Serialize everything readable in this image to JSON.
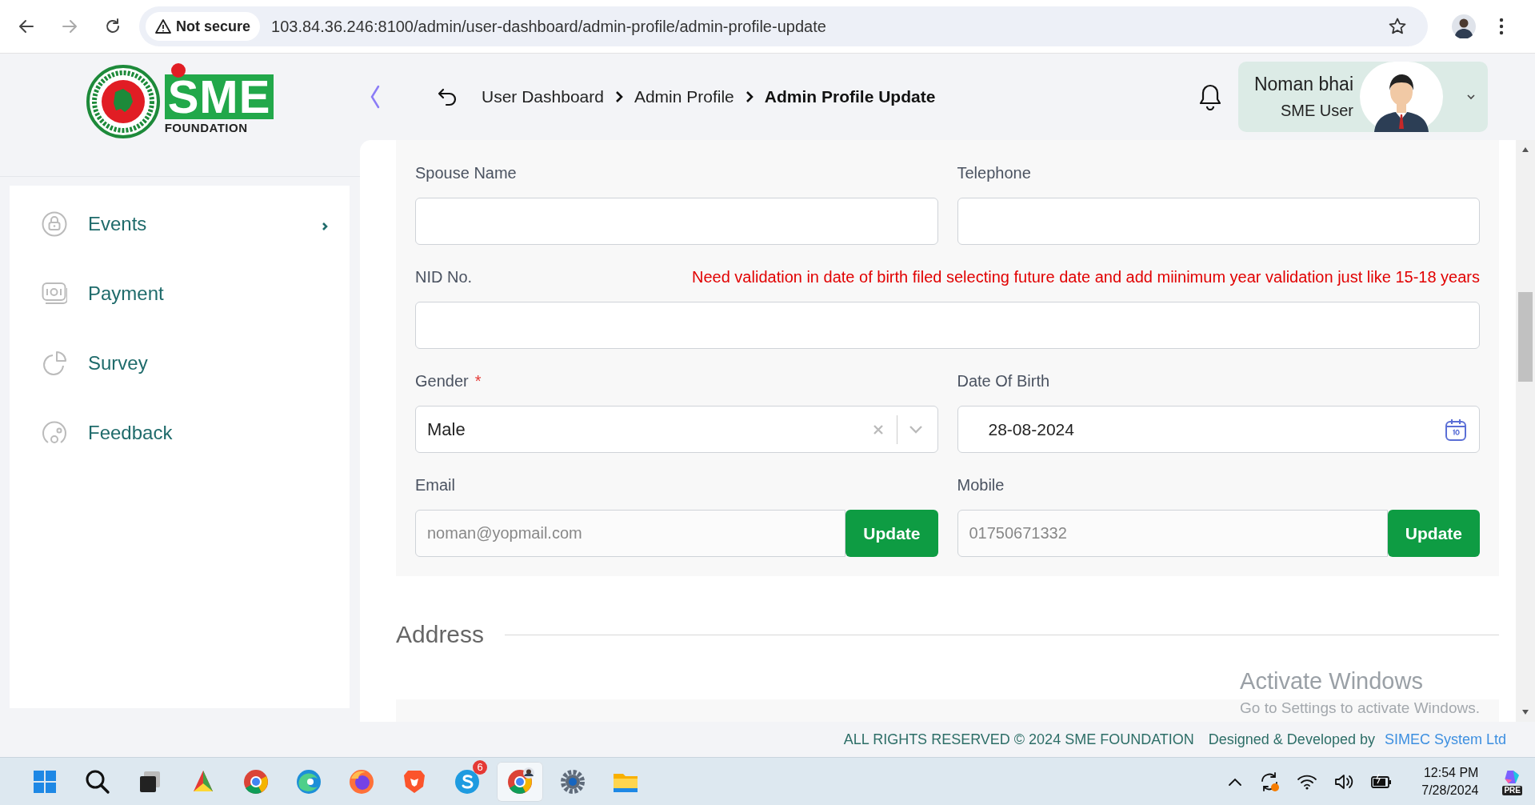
{
  "browser": {
    "security": "Not secure",
    "url": "103.84.36.246:8100/admin/user-dashboard/admin-profile/admin-profile-update"
  },
  "logo": {
    "letters": "SME",
    "subtitle": "FOUNDATION"
  },
  "breadcrumb": [
    {
      "label": "User Dashboard",
      "current": false
    },
    {
      "label": "Admin Profile",
      "current": false
    },
    {
      "label": "Admin Profile Update",
      "current": true
    }
  ],
  "user": {
    "name": "Noman bhai",
    "role": "SME User"
  },
  "sidebar": {
    "items": [
      {
        "label": "Events",
        "kind": "lock",
        "has_submenu": true
      },
      {
        "label": "Payment",
        "kind": "cash",
        "has_submenu": false
      },
      {
        "label": "Survey",
        "kind": "pie",
        "has_submenu": false
      },
      {
        "label": "Feedback",
        "kind": "circles",
        "has_submenu": false
      }
    ]
  },
  "form": {
    "fields": [
      {
        "label": "Spouse Name",
        "kind": "text"
      },
      {
        "label": "Telephone",
        "kind": "text"
      },
      {
        "label": "NID No.",
        "kind": "text",
        "full_width": true,
        "note": "Need validation in date of birth filed selecting future date and add miinimum year validation just like 15-18 years"
      },
      {
        "label": "Gender",
        "kind": "select",
        "required_mark": "*",
        "value": "Male"
      },
      {
        "label": "Date Of Birth",
        "kind": "date",
        "value": "28-08-2024"
      },
      {
        "label": "Email",
        "kind": "update",
        "value": "noman@yopmail.com",
        "disabled": true,
        "button": "Update"
      },
      {
        "label": "Mobile",
        "kind": "update",
        "value": "01750671332",
        "disabled": true,
        "button": "Update"
      }
    ]
  },
  "address": {
    "title": "Address"
  },
  "activation": {
    "title": "Activate Windows",
    "hint": "Go to Settings to activate Windows."
  },
  "footer": {
    "copyright": "ALL RIGHTS RESERVED © 2024 SME FOUNDATION",
    "credit": "Designed & Developed by",
    "link": "SIMEC System Ltd"
  },
  "taskbar": {
    "apps": [
      {
        "kind": "start",
        "selected": false
      },
      {
        "kind": "search",
        "selected": false
      },
      {
        "kind": "taskview",
        "selected": false
      },
      {
        "kind": "pinwheel",
        "selected": false
      },
      {
        "kind": "chrome",
        "selected": false
      },
      {
        "kind": "edge",
        "selected": false
      },
      {
        "kind": "firefox",
        "selected": false
      },
      {
        "kind": "brave",
        "selected": false
      },
      {
        "kind": "skype",
        "selected": false,
        "badge": "6"
      },
      {
        "kind": "chromeprofile",
        "selected": true
      },
      {
        "kind": "settings",
        "selected": false
      },
      {
        "kind": "files",
        "selected": false
      }
    ],
    "time": "12:54 PM",
    "date": "7/28/2024",
    "copilot_badge": "PRE"
  }
}
